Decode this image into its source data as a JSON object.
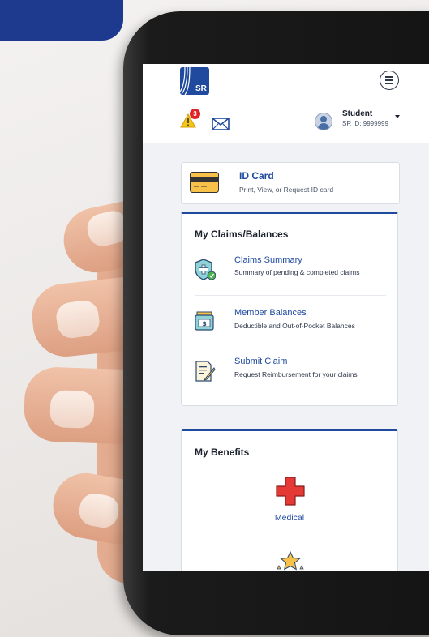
{
  "header": {
    "logo_text": "SR"
  },
  "alerts": {
    "count": "3"
  },
  "user": {
    "name": "Student",
    "id": "SR ID: 9999999"
  },
  "id_card": {
    "title": "ID Card",
    "subtitle": "Print, View, or Request ID card"
  },
  "claims": {
    "title": "My Claims/Balances",
    "items": [
      {
        "title": "Claims Summary",
        "subtitle": "Summary of pending & completed claims",
        "icon": "shield-plus-icon"
      },
      {
        "title": "Member Balances",
        "subtitle": "Deductible and Out-of-Pocket Balances",
        "icon": "wallet-dollar-icon"
      },
      {
        "title": "Submit Claim",
        "subtitle": "Request Reimbursement for your claims",
        "icon": "document-pen-icon"
      }
    ]
  },
  "benefits": {
    "title": "My Benefits",
    "items": [
      {
        "label": "Medical",
        "icon": "red-cross-icon"
      }
    ]
  },
  "colors": {
    "brand": "#1f4a9e",
    "alert": "#e02424",
    "warning": "#f5c518",
    "medical": "#e53935"
  }
}
